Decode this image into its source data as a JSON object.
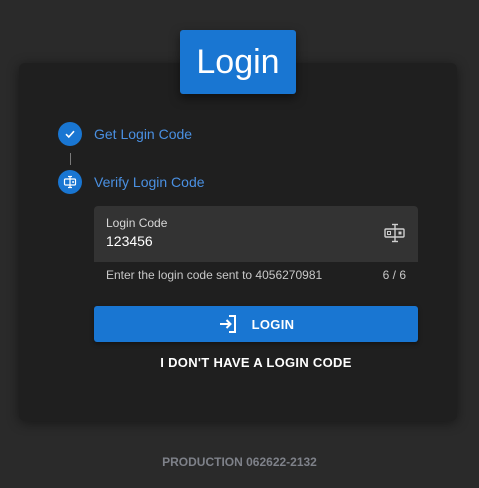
{
  "page": {
    "title": "Login"
  },
  "steps": [
    {
      "label": "Get Login Code",
      "icon": "check-icon",
      "status": "complete"
    },
    {
      "label": "Verify Login Code",
      "icon": "keypad-icon",
      "status": "active"
    }
  ],
  "login_code_field": {
    "label": "Login Code",
    "value": "123456",
    "icon": "input-cursor-icon",
    "helper": "Enter the login code sent to 4056270981",
    "counter": "6 / 6"
  },
  "actions": {
    "login_label": "LOGIN",
    "login_icon": "login-icon",
    "no_code_label": "I DON'T HAVE A LOGIN CODE"
  },
  "footer": {
    "version": "PRODUCTION 062622-2132"
  },
  "colors": {
    "accent": "#1976d2",
    "link": "#4a90e2",
    "background": "#2a2a2a",
    "card": "#1f1f1f"
  }
}
